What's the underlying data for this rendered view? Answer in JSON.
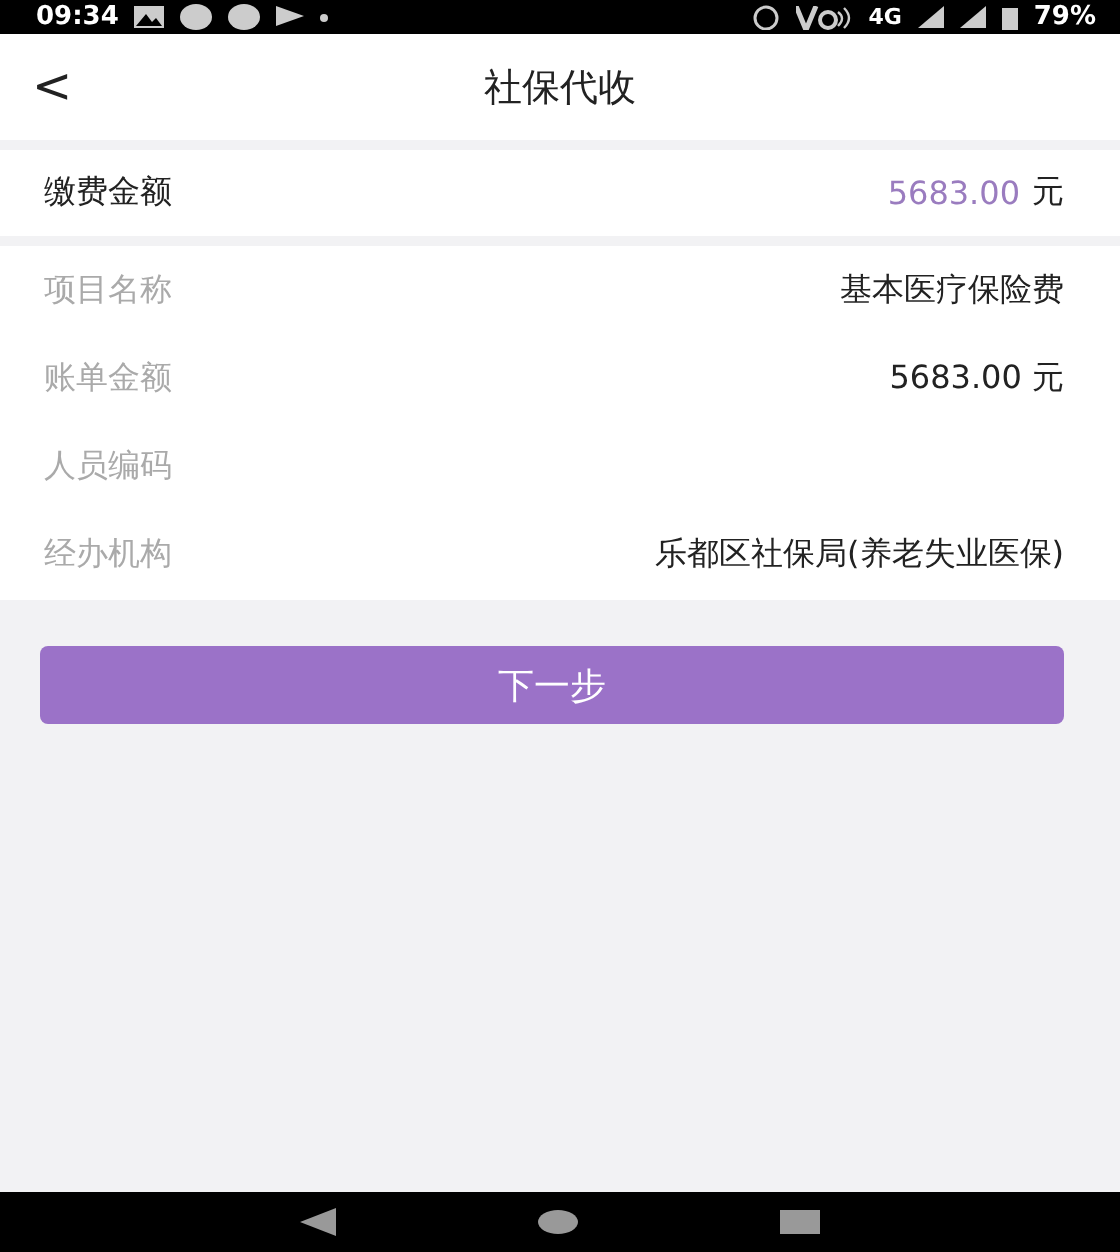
{
  "status_bar": {
    "time": "09:34",
    "network": "4G",
    "battery": "79%"
  },
  "header": {
    "back": "<",
    "title": "社保代收"
  },
  "payment": {
    "label": "缴费金额",
    "amount": "5683.00",
    "unit": "元"
  },
  "details": [
    {
      "label": "项目名称",
      "value": "基本医疗保险费"
    },
    {
      "label": "账单金额",
      "value": "5683.00 元"
    },
    {
      "label": "人员编码"
    },
    {
      "label": "经办机构",
      "value": "乐都区社保局(养老失业医保)"
    }
  ],
  "next_button": "下一步"
}
